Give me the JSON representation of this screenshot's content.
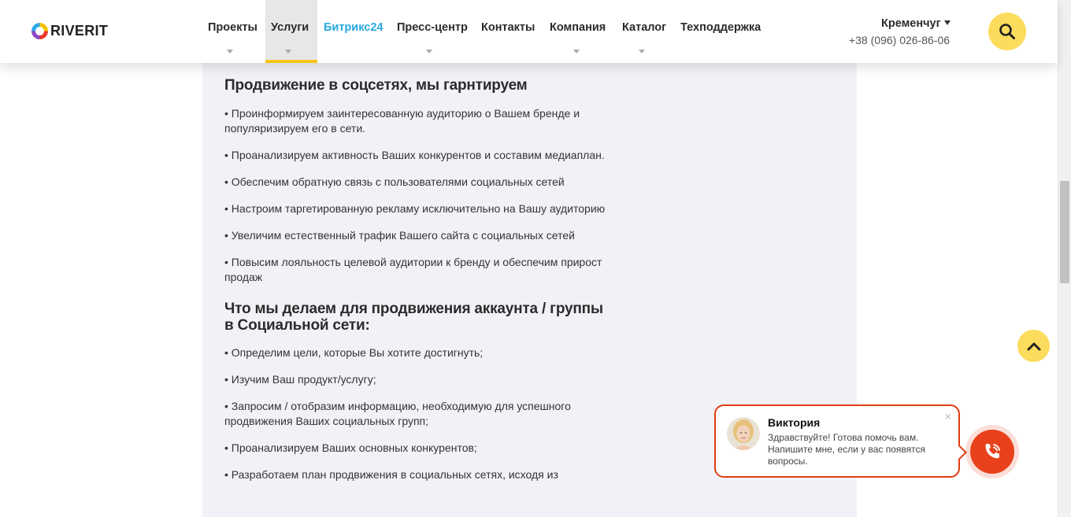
{
  "header": {
    "logo_text": "RIVERIT",
    "nav": [
      {
        "label": "Проекты",
        "dropdown": true
      },
      {
        "label": "Услуги",
        "dropdown": true,
        "active": true
      },
      {
        "label": "Битрикс24",
        "dropdown": false,
        "color": "#27a9e1"
      },
      {
        "label": "Пресс-центр",
        "dropdown": true
      },
      {
        "label": "Контакты",
        "dropdown": false
      },
      {
        "label": "Компания",
        "dropdown": true
      },
      {
        "label": "Каталог",
        "dropdown": true
      },
      {
        "label": "Техподдержка",
        "dropdown": false
      }
    ],
    "city": "Кременчуг",
    "phone": "+38 (096) 026-86-06",
    "search_icon": "search-icon"
  },
  "article": {
    "heading1": "Продвижение в соцсетях, мы гарнтируем",
    "list1": [
      "• Проинформируем заинтересованную аудиторию о Вашем бренде и популяризируем его в сети.",
      "•  Проанализируем активность Ваших конкурентов и составим медиаплан.",
      "•  Обеспечим обратную связь с пользователями социальных сетей",
      "•  Настроим таргетированную рекламу исключительно на Вашу аудиторию",
      "•  Увеличим естественный трафик Вашего сайта с социальных сетей",
      "•  Повысим лояльность целевой аудитории к бренду и обеспечим прирост продаж"
    ],
    "heading2": "Что мы делаем для продвижения аккаунта / группы в Социальной сети:",
    "list2": [
      "• Определим цели, которые Вы хотите достигнуть;",
      "•  Изучим Ваш продукт/услугу;",
      "•  Запросим / отобразим информацию, необходимую для успешного продвижения Ваших социальных групп;",
      "•  Проанализируем Ваших основных конкурентов;",
      "•  Разработаем план продвижения в социальных сетях, исходя из"
    ]
  },
  "chat": {
    "name": "Виктория",
    "message": "Здравствуйте! Готова помочь вам. Напишите мне, если у вас появятся вопросы.",
    "close": "×"
  },
  "colors": {
    "accent_yellow": "#fbdc5c",
    "chat_red": "#e8411b",
    "link_blue": "#27a9e1"
  }
}
